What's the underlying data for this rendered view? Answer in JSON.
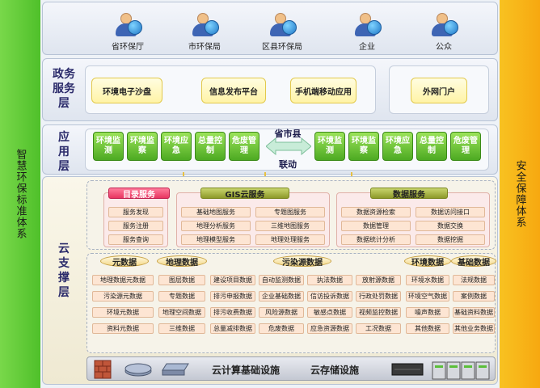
{
  "side_left": "智慧环保标准体系",
  "side_right": "安全保障体系",
  "users": [
    "省环保厅",
    "市环保局",
    "区县环保局",
    "企业",
    "公众"
  ],
  "gov": {
    "title": "政务服务层",
    "items": [
      "环境电子沙盘",
      "信息发布平台",
      "手机端移动应用"
    ],
    "external": "外网门户"
  },
  "app": {
    "title": "应用层",
    "left_items": [
      "环境监测",
      "环境监察",
      "环境应急",
      "总量控制",
      "危废管理"
    ],
    "right_items": [
      "环境监测",
      "环境监察",
      "环境应急",
      "总量控制",
      "危废管理"
    ],
    "center_top": "省市县",
    "center_bottom": "联动"
  },
  "cloud": {
    "title": "云支撑层",
    "catalog": {
      "name": "目录服务",
      "items": [
        "服务发现",
        "服务注册",
        "服务查询"
      ]
    },
    "gis": {
      "name": "GIS云服务",
      "items": [
        "基础地图服务",
        "专题图服务",
        "地理分析服务",
        "三维地图服务",
        "地理模型服务",
        "地理处理服务"
      ]
    },
    "data_service": {
      "name": "数据服务",
      "items": [
        "数据资源检索",
        "数据访问接口",
        "数据管理",
        "数据交换",
        "数据统计分析",
        "数据挖掘"
      ]
    },
    "meta": {
      "name": "元数据",
      "items": [
        "地理数据元数据",
        "污染源元数据",
        "环境元数据",
        "资料元数据"
      ]
    },
    "geo": {
      "name": "地理数据",
      "items": [
        "图层数据",
        "专题数据",
        "地理空间数据",
        "三维数据"
      ]
    },
    "pollution": {
      "name": "污染源数据",
      "items": [
        "建设项目数据",
        "自动监测数据",
        "执法数据",
        "放射源数据",
        "排污申报数据",
        "企业基础数据",
        "信访投诉数据",
        "行政处罚数据",
        "排污收费数据",
        "风险源数据",
        "敏感点数据",
        "视频监控数据",
        "总量减排数据",
        "危废数据",
        "应急资源数据",
        "工况数据"
      ]
    },
    "env": {
      "name": "环境数据",
      "items": [
        "环境水数据",
        "环境空气数据",
        "噪声数据",
        "其他数据"
      ]
    },
    "base": {
      "name": "基础数据",
      "items": [
        "法规数据",
        "案例数据",
        "基础资料数据",
        "其他业务数据"
      ]
    },
    "infra_compute": "云计算基础设施",
    "infra_storage": "云存储设施"
  }
}
